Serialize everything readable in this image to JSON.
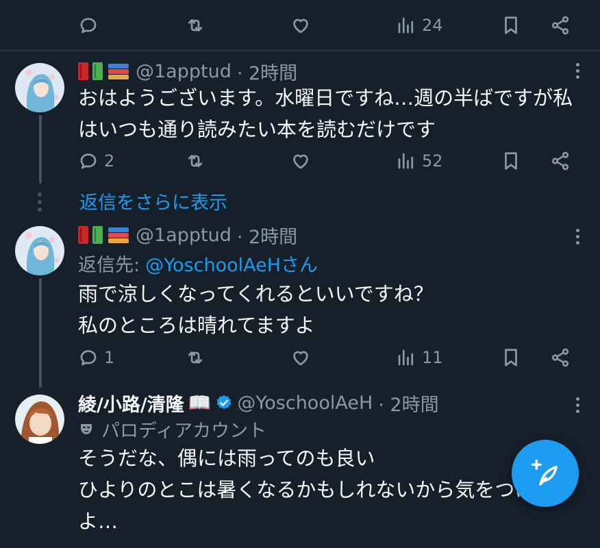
{
  "colors": {
    "background": "#15202b",
    "accent": "#1d9bf0",
    "muted": "#8b98a5",
    "text": "#f7f9f9"
  },
  "top_actions": {
    "views": "24"
  },
  "tweet1": {
    "emoji_handle": "📕📗📚",
    "handle": "@1apptud",
    "time": "· 2時間",
    "text": "おはようございます。水曜日ですね…週の半ばですが私\nはいつも通り読みたい本を読むだけです",
    "replies": "2",
    "views": "52"
  },
  "show_more_replies": "返信をさらに表示",
  "tweet2": {
    "emoji_handle": "📕📗📚",
    "handle": "@1apptud",
    "time": "· 2時間",
    "reply_to_label": "返信先:",
    "reply_to_mention": "@YoschoolAeHさん",
    "text": "雨で涼しくなってくれるといいですね？\n私のところは晴れてますよ",
    "replies": "1",
    "views": "11"
  },
  "tweet3": {
    "name": "綾/小路/清隆",
    "name_emoji": "📖",
    "handle": "@YoschoolAeH",
    "time": "· 2時間",
    "parody_label": "パロディアカウント",
    "text": "そうだな、偶には雨ってのも良い\nひよりのとこは暑くなるかもしれないから気をつけろ\nよ…"
  },
  "icons": [
    "reply-icon",
    "retweet-icon",
    "like-icon",
    "views-icon",
    "bookmark-icon",
    "share-icon",
    "more-icon",
    "verified-icon",
    "mask-icon",
    "compose-icon"
  ]
}
